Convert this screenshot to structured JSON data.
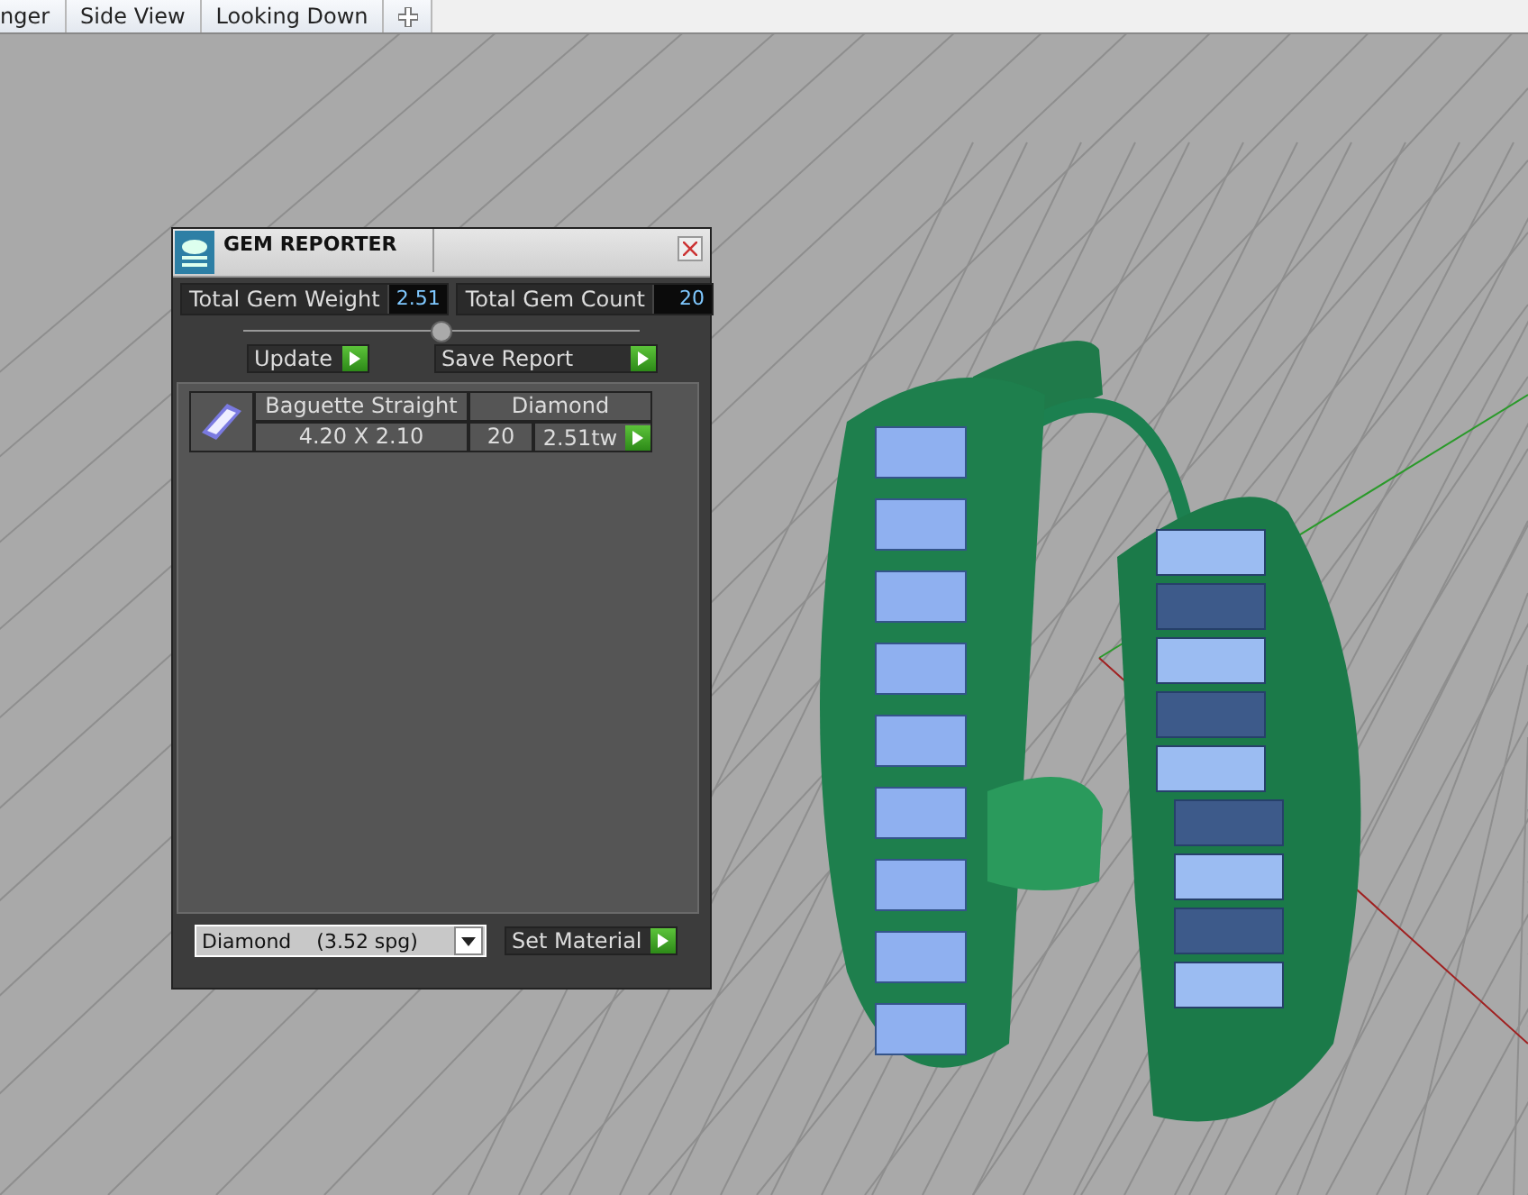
{
  "tabs": [
    {
      "label": "nger"
    },
    {
      "label": "Side View"
    },
    {
      "label": "Looking Down"
    }
  ],
  "gem_reporter": {
    "title": "GEM REPORTER",
    "stats": [
      {
        "label": "Total Gem Weight",
        "value": "2.51"
      },
      {
        "label": "Total Gem Count",
        "value": "20"
      }
    ],
    "buttons": [
      {
        "label": "Update"
      },
      {
        "label": "Save Report"
      }
    ],
    "gems": [
      {
        "cut": "Baguette Straight",
        "material": "Diamond",
        "size": "4.20 X 2.10",
        "count": "20",
        "weight": "2.51tw"
      }
    ],
    "material_select": {
      "value": "Diamond    (3.52 spg)"
    },
    "set_button": "Set Material"
  }
}
